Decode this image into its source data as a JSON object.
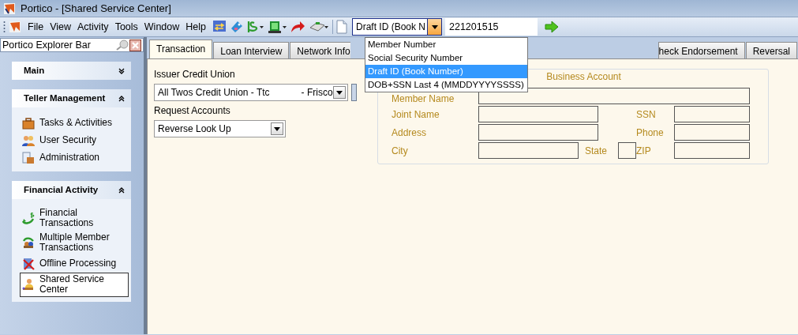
{
  "window": {
    "title": "Portico - [Shared Service Center]"
  },
  "menu": [
    "File",
    "View",
    "Activity",
    "Tools",
    "Window",
    "Help"
  ],
  "search": {
    "type_value": "Draft ID (Book N",
    "value": "221201515",
    "type_options": [
      {
        "label": "Member Number",
        "selected": false
      },
      {
        "label": "Social Security Number",
        "selected": false
      },
      {
        "label": "Draft ID (Book Number)",
        "selected": true
      },
      {
        "label": "DOB+SSN Last 4 (MMDDYYYYSSSS)",
        "selected": false
      }
    ]
  },
  "explorer_bar": {
    "title": "Portico Explorer Bar",
    "groups": [
      {
        "title": "Main",
        "expanded": false
      },
      {
        "title": "Teller Management",
        "expanded": true,
        "items": [
          {
            "label": "Tasks & Activities",
            "selected": false
          },
          {
            "label": "User Security",
            "selected": false
          },
          {
            "label": "Administration",
            "selected": false
          }
        ]
      },
      {
        "title": "Financial Activity",
        "expanded": true,
        "items": [
          {
            "label": "Financial Transactions",
            "selected": false
          },
          {
            "label": "Multiple Member Transactions",
            "selected": false
          },
          {
            "label": "Offline Processing",
            "selected": false
          },
          {
            "label": "Shared Service Center",
            "selected": true
          }
        ]
      }
    ]
  },
  "tabs": [
    {
      "label": "Transaction",
      "selected": true
    },
    {
      "label": "Loan Interview",
      "selected": false
    },
    {
      "label": "Network Info",
      "selected": false
    },
    {
      "label": "heck Endorsement",
      "selected": false
    },
    {
      "label": "Reversal",
      "selected": false
    }
  ],
  "form": {
    "issuer_label": "Issuer Credit Union",
    "issuer_value": "All Twos Credit Union - Ttc",
    "issuer_city": "-  Frisco",
    "request_label": "Request Accounts",
    "request_value": "Reverse Look Up"
  },
  "business_account": {
    "title": "Business Account",
    "fields": [
      {
        "label": "Member Name",
        "kind": "wide"
      },
      {
        "label": "Joint Name",
        "kind": "medium"
      },
      {
        "label": "SSN",
        "kind": "short"
      },
      {
        "label": "Address",
        "kind": "medium"
      },
      {
        "label": "Phone",
        "kind": "short"
      },
      {
        "label": "City",
        "kind": "small"
      },
      {
        "label": "State",
        "kind": "tiny"
      },
      {
        "label": "ZIP",
        "kind": "short"
      }
    ]
  }
}
